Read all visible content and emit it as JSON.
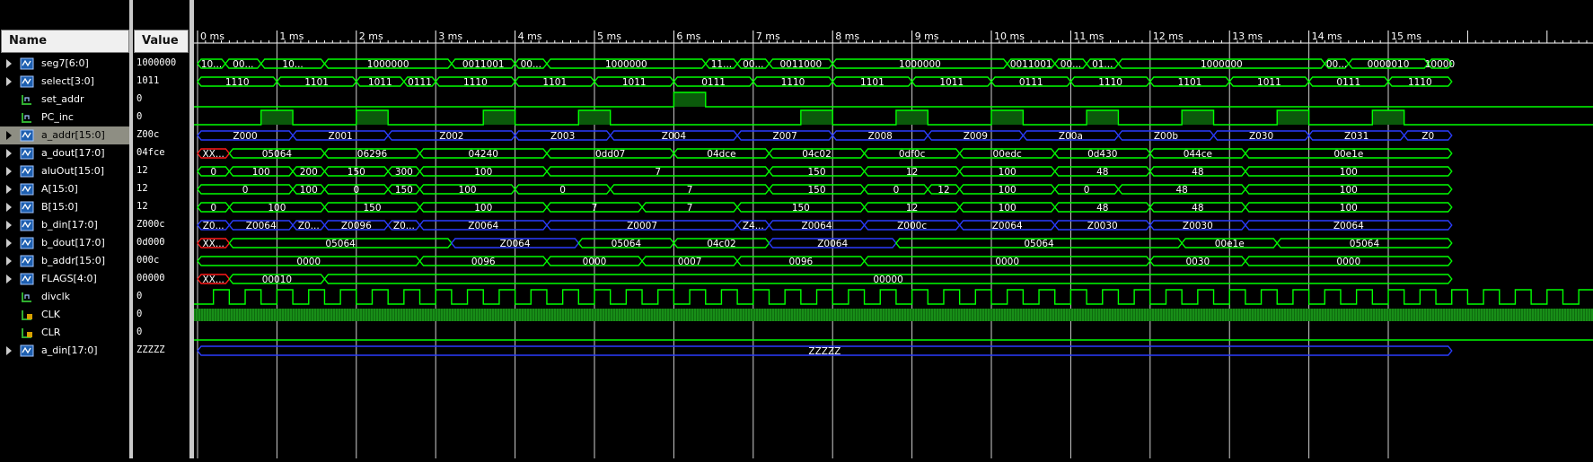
{
  "headers": {
    "name": "Name",
    "value": "Value"
  },
  "time_axis": {
    "unit": "ms",
    "labels": [
      "0 ms",
      "1 ms",
      "2 ms",
      "3 ms",
      "4 ms",
      "5 ms",
      "6 ms",
      "7 ms",
      "8 ms",
      "9 ms",
      "10 ms",
      "11 ms",
      "12 ms",
      "13 ms",
      "14 ms",
      "15 ms"
    ]
  },
  "colors": {
    "bus": "#00ff00",
    "bus_highz": "#2a3cff",
    "bus_x": "#ff1a1a",
    "bit": "#00ff00",
    "cursor": "#ffffff"
  },
  "signals": [
    {
      "name": "seg7[6:0]",
      "value": "1000000",
      "type": "bus",
      "expandable": true,
      "icon": "bus-signal-icon",
      "segments": [
        [
          0,
          0.35,
          "10..."
        ],
        [
          0.35,
          0.8,
          "00..."
        ],
        [
          0.8,
          1.6,
          "10..."
        ],
        [
          1.6,
          3.2,
          "1000000"
        ],
        [
          3.2,
          4.0,
          "0011001"
        ],
        [
          4.0,
          4.4,
          "00..."
        ],
        [
          4.4,
          6.4,
          "1000000"
        ],
        [
          6.4,
          6.8,
          "11..."
        ],
        [
          6.8,
          7.2,
          "00..."
        ],
        [
          7.2,
          8.0,
          "0011000"
        ],
        [
          8.0,
          10.2,
          "1000000"
        ],
        [
          10.2,
          10.8,
          "0011001"
        ],
        [
          10.8,
          11.2,
          "00..."
        ],
        [
          11.2,
          11.6,
          "01..."
        ],
        [
          11.6,
          14.2,
          "1000000"
        ],
        [
          14.2,
          14.5,
          "00..."
        ],
        [
          14.5,
          15.5,
          "0000010"
        ],
        [
          15.5,
          15.8,
          "10000"
        ]
      ]
    },
    {
      "name": "select[3:0]",
      "value": "1011",
      "type": "bus",
      "expandable": true,
      "icon": "bus-signal-icon",
      "segments": [
        [
          0,
          1,
          "1110"
        ],
        [
          1,
          2,
          "1101"
        ],
        [
          2,
          2.6,
          "1011"
        ],
        [
          2.6,
          3,
          "0111"
        ],
        [
          3,
          4,
          "1110"
        ],
        [
          4,
          5,
          "1101"
        ],
        [
          5,
          6,
          "1011"
        ],
        [
          6,
          7,
          "0111"
        ],
        [
          7,
          8,
          "1110"
        ],
        [
          8,
          9,
          "1101"
        ],
        [
          9,
          10,
          "1011"
        ],
        [
          10,
          11,
          "0111"
        ],
        [
          11,
          12,
          "1110"
        ],
        [
          12,
          13,
          "1101"
        ],
        [
          13,
          14,
          "1011"
        ],
        [
          14,
          15,
          "0111"
        ],
        [
          15,
          15.8,
          "1110"
        ]
      ]
    },
    {
      "name": "set_addr",
      "value": "0",
      "type": "bit",
      "expandable": false,
      "icon": "bit-signal-icon",
      "pulses": [
        [
          6,
          6.4
        ]
      ]
    },
    {
      "name": "PC_inc",
      "value": "0",
      "type": "bit",
      "expandable": false,
      "icon": "bit-signal-icon",
      "pulses": [
        [
          0.8,
          1.2
        ],
        [
          2,
          2.4
        ],
        [
          3.6,
          4
        ],
        [
          4.8,
          5.2
        ],
        [
          7.6,
          8
        ],
        [
          8.8,
          9.2
        ],
        [
          10,
          10.4
        ],
        [
          11.2,
          11.6
        ],
        [
          12.4,
          12.8
        ],
        [
          13.6,
          14
        ],
        [
          14.8,
          15.2
        ]
      ]
    },
    {
      "name": "a_addr[15:0]",
      "value": "Z00c",
      "type": "bus",
      "expandable": true,
      "icon": "bus-signal-icon",
      "selected": true,
      "highz": true,
      "segments": [
        [
          0,
          1.2,
          "Z000"
        ],
        [
          1.2,
          2.4,
          "Z001"
        ],
        [
          2.4,
          4,
          "Z002"
        ],
        [
          4,
          5.2,
          "Z003"
        ],
        [
          5.2,
          6.8,
          "Z004"
        ],
        [
          6.8,
          8,
          "Z007"
        ],
        [
          8,
          9.2,
          "Z008"
        ],
        [
          9.2,
          10.4,
          "Z009"
        ],
        [
          10.4,
          11.6,
          "Z00a"
        ],
        [
          11.6,
          12.8,
          "Z00b"
        ],
        [
          12.8,
          14,
          "Z030"
        ],
        [
          14,
          15.2,
          "Z031"
        ],
        [
          15.2,
          15.8,
          "Z0"
        ]
      ]
    },
    {
      "name": "a_dout[17:0]",
      "value": "04fce",
      "type": "bus",
      "expandable": true,
      "icon": "bus-signal-icon",
      "segments": [
        [
          0,
          0.4,
          "XX...",
          "x"
        ],
        [
          0.4,
          1.6,
          "05064"
        ],
        [
          1.6,
          2.8,
          "06296"
        ],
        [
          2.8,
          4.4,
          "04240"
        ],
        [
          4.4,
          6,
          "0dd07"
        ],
        [
          6,
          7.2,
          "04dce"
        ],
        [
          7.2,
          8.4,
          "04c02"
        ],
        [
          8.4,
          9.6,
          "0df0c"
        ],
        [
          9.6,
          10.8,
          "00edc"
        ],
        [
          10.8,
          12,
          "0d430"
        ],
        [
          12,
          13.2,
          "044ce"
        ],
        [
          13.2,
          15.8,
          "00e1e"
        ]
      ]
    },
    {
      "name": "aluOut[15:0]",
      "value": "12",
      "type": "bus",
      "expandable": true,
      "icon": "bus-signal-icon",
      "segments": [
        [
          0,
          0.4,
          "0"
        ],
        [
          0.4,
          1.2,
          "100"
        ],
        [
          1.2,
          1.6,
          "200"
        ],
        [
          1.6,
          2.4,
          "150"
        ],
        [
          2.4,
          2.8,
          "300"
        ],
        [
          2.8,
          4.4,
          "100"
        ],
        [
          4.4,
          7.2,
          "7"
        ],
        [
          7.2,
          8.4,
          "150"
        ],
        [
          8.4,
          9.6,
          "12"
        ],
        [
          9.6,
          10.8,
          "100"
        ],
        [
          10.8,
          12,
          "48"
        ],
        [
          12,
          13.2,
          "48"
        ],
        [
          13.2,
          15.8,
          "100"
        ]
      ]
    },
    {
      "name": "A[15:0]",
      "value": "12",
      "type": "bus",
      "expandable": true,
      "icon": "bus-signal-icon",
      "segments": [
        [
          0,
          1.2,
          "0"
        ],
        [
          1.2,
          1.6,
          "100"
        ],
        [
          1.6,
          2.4,
          "0"
        ],
        [
          2.4,
          2.8,
          "150"
        ],
        [
          2.8,
          4,
          "100"
        ],
        [
          4,
          5.2,
          "0"
        ],
        [
          5.2,
          7.2,
          "7"
        ],
        [
          7.2,
          8.4,
          "150"
        ],
        [
          8.4,
          9.2,
          "0"
        ],
        [
          9.2,
          9.6,
          "12"
        ],
        [
          9.6,
          10.8,
          "100"
        ],
        [
          10.8,
          11.6,
          "0"
        ],
        [
          11.6,
          13.2,
          "48"
        ],
        [
          13.2,
          15.8,
          "100"
        ]
      ]
    },
    {
      "name": "B[15:0]",
      "value": "12",
      "type": "bus",
      "expandable": true,
      "icon": "bus-signal-icon",
      "segments": [
        [
          0,
          0.4,
          "0"
        ],
        [
          0.4,
          1.6,
          "100"
        ],
        [
          1.6,
          2.8,
          "150"
        ],
        [
          2.8,
          4.4,
          "100"
        ],
        [
          4.4,
          5.6,
          "7"
        ],
        [
          5.6,
          6.8,
          "7"
        ],
        [
          6.8,
          8.4,
          "150"
        ],
        [
          8.4,
          9.6,
          "12"
        ],
        [
          9.6,
          10.8,
          "100"
        ],
        [
          10.8,
          12,
          "48"
        ],
        [
          12,
          13.2,
          "48"
        ],
        [
          13.2,
          15.8,
          "100"
        ]
      ]
    },
    {
      "name": "b_din[17:0]",
      "value": "Z000c",
      "type": "bus",
      "expandable": true,
      "icon": "bus-signal-icon",
      "highz": true,
      "segments": [
        [
          0,
          0.4,
          "Z0..."
        ],
        [
          0.4,
          1.2,
          "Z0064"
        ],
        [
          1.2,
          1.6,
          "Z0..."
        ],
        [
          1.6,
          2.4,
          "Z0096"
        ],
        [
          2.4,
          2.8,
          "Z0..."
        ],
        [
          2.8,
          4.4,
          "Z0064"
        ],
        [
          4.4,
          6.8,
          "Z0007"
        ],
        [
          6.8,
          7.2,
          "Z4..."
        ],
        [
          7.2,
          8.4,
          "Z0064"
        ],
        [
          8.4,
          9.6,
          "Z000c"
        ],
        [
          9.6,
          10.8,
          "Z0064"
        ],
        [
          10.8,
          12,
          "Z0030"
        ],
        [
          12,
          13.2,
          "Z0030"
        ],
        [
          13.2,
          15.8,
          "Z0064"
        ]
      ]
    },
    {
      "name": "b_dout[17:0]",
      "value": "0d000",
      "type": "bus",
      "expandable": true,
      "icon": "bus-signal-icon",
      "segments": [
        [
          0,
          0.4,
          "XX...",
          "x"
        ],
        [
          0.4,
          3.2,
          "05064"
        ],
        [
          3.2,
          4.8,
          "Z0064",
          "z"
        ],
        [
          4.8,
          6,
          "05064"
        ],
        [
          6,
          7.2,
          "04c02"
        ],
        [
          7.2,
          8.8,
          "Z0064",
          "z"
        ],
        [
          8.8,
          12.4,
          "05064"
        ],
        [
          12.4,
          13.6,
          "00e1e"
        ],
        [
          13.6,
          15.8,
          "05064"
        ]
      ]
    },
    {
      "name": "b_addr[15:0]",
      "value": "000c",
      "type": "bus",
      "expandable": true,
      "icon": "bus-signal-icon",
      "segments": [
        [
          0,
          2.8,
          "0000"
        ],
        [
          2.8,
          4.4,
          "0096"
        ],
        [
          4.4,
          5.6,
          "0000"
        ],
        [
          5.6,
          6.8,
          "0007"
        ],
        [
          6.8,
          8.4,
          "0096"
        ],
        [
          8.4,
          12,
          "0000"
        ],
        [
          12,
          13.2,
          "0030"
        ],
        [
          13.2,
          15.8,
          "0000"
        ]
      ]
    },
    {
      "name": "FLAGS[4:0]",
      "value": "00000",
      "type": "bus",
      "expandable": true,
      "icon": "bus-signal-icon",
      "segments": [
        [
          0,
          0.4,
          "XX...",
          "x"
        ],
        [
          0.4,
          1.6,
          "00010"
        ],
        [
          1.6,
          15.8,
          "00000"
        ]
      ]
    },
    {
      "name": "divclk",
      "value": "0",
      "type": "clock",
      "expandable": false,
      "icon": "bit-signal-icon",
      "period": 0.4
    },
    {
      "name": "CLK",
      "value": "0",
      "type": "fastclock",
      "expandable": false,
      "icon": "lock-bit-signal-icon"
    },
    {
      "name": "CLR",
      "value": "0",
      "type": "bit",
      "expandable": false,
      "icon": "lock-bit-signal-icon",
      "pulses": []
    },
    {
      "name": "a_din[17:0]",
      "value": "ZZZZZ",
      "type": "bus",
      "expandable": true,
      "icon": "bus-signal-icon",
      "highz": true,
      "segments": [
        [
          0,
          15.8,
          "ZZZZZ"
        ]
      ]
    }
  ]
}
